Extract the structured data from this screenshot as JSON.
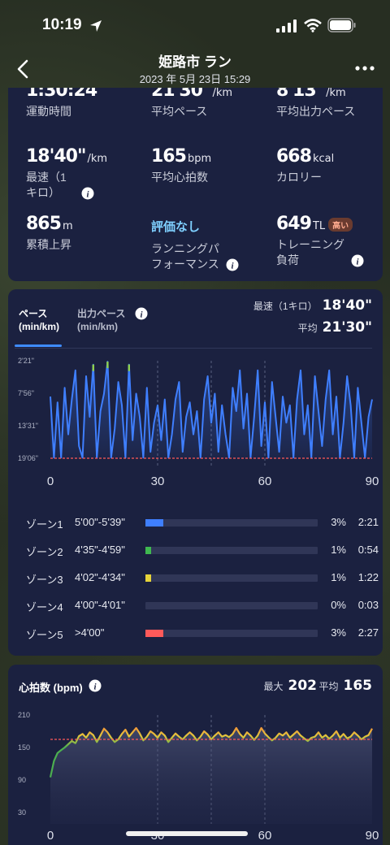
{
  "status_bar": {
    "time": "10:19"
  },
  "header": {
    "title": "姫路市 ラン",
    "subtitle": "2023 年 5月 23日 15:29"
  },
  "stats": {
    "row0": [
      {
        "value": "1:30:24",
        "unit": "",
        "label": "運動時間"
      },
      {
        "value": "21'30\"",
        "unit": "/km",
        "label": "平均ペース"
      },
      {
        "value": "8'13\"",
        "unit": "/km",
        "label": "平均出力ペース"
      }
    ],
    "row1": [
      {
        "value": "18'40\"",
        "unit": "/km",
        "label_line1": "最速（1",
        "label_line2": "キロ）"
      },
      {
        "value": "165",
        "unit": "bpm",
        "label": "平均心拍数"
      },
      {
        "value": "668",
        "unit": "kcal",
        "label": "カロリー"
      }
    ],
    "row2": [
      {
        "value": "865",
        "unit": "m",
        "label": "累積上昇"
      },
      {
        "value": "評価なし",
        "label_line1": "ランニングパ",
        "label_line2": "フォーマンス"
      },
      {
        "value": "649",
        "unit": "TL",
        "badge": "高い",
        "label_line1": "トレーニング",
        "label_line2": "負荷"
      }
    ]
  },
  "pace": {
    "tabs": [
      {
        "line1": "ペース",
        "line2": "(min/km)"
      },
      {
        "line1": "出力ペース",
        "line2": "(min/km)"
      }
    ],
    "fastest_label": "最速（1キロ）",
    "fastest_value": "18'40\"",
    "avg_label": "平均",
    "avg_value": "21'30\"",
    "zones": [
      {
        "name": "ゾーン1",
        "range": "5'00\"-5'39\"",
        "pct": "3%",
        "time": "2:21",
        "fraction": 0.03,
        "color": "#3f7fff"
      },
      {
        "name": "ゾーン2",
        "range": "4'35\"-4'59\"",
        "pct": "1%",
        "time": "0:54",
        "fraction": 0.01,
        "color": "#3fb950"
      },
      {
        "name": "ゾーン3",
        "range": "4'02\"-4'34\"",
        "pct": "1%",
        "time": "1:22",
        "fraction": 0.01,
        "color": "#e6d33a"
      },
      {
        "name": "ゾーン4",
        "range": "4'00\"-4'01\"",
        "pct": "0%",
        "time": "0:03",
        "fraction": 0.0,
        "color": "#f08a3a"
      },
      {
        "name": "ゾーン5",
        "range": ">4'00\"",
        "pct": "3%",
        "time": "2:27",
        "fraction": 0.03,
        "color": "#ff5a5a"
      }
    ]
  },
  "heart_rate": {
    "title": "心拍数 (bpm)",
    "max_label": "最大",
    "max_value": "202",
    "avg_label": "平均",
    "avg_value": "165"
  },
  "chart_data": [
    {
      "type": "line",
      "series": [
        {
          "values": [
            8.5,
            19.0,
            9.5,
            19.0,
            7.0,
            15.0,
            9.0,
            4.0,
            17.0,
            19.0,
            5.0,
            12.0,
            3.0,
            19.0,
            11.0,
            8.0,
            2.5,
            19.0,
            14.0,
            6.0,
            10.0,
            19.0,
            3.0,
            16.0,
            8.0,
            12.0,
            19.0,
            7.0,
            18.0,
            13.0,
            10.0,
            16.0,
            9.0,
            19.0,
            15.0,
            9.0,
            6.0,
            18.0,
            12.0,
            9.5,
            15.0,
            11.0,
            19.0,
            9.0,
            5.0,
            13.0,
            8.0,
            18.0,
            10.0,
            15.0,
            19.0,
            7.0,
            11.0,
            4.0,
            14.0,
            8.0,
            19.0,
            12.0,
            4.0,
            17.0,
            9.5,
            19.0,
            6.0,
            12.0,
            18.0,
            8.5,
            13.0,
            10.0,
            19.0,
            9.0,
            4.0,
            15.0,
            10.0,
            19.0,
            5.0,
            11.0,
            17.0,
            9.0,
            4.0,
            15.0,
            8.5,
            19.0,
            13.0,
            5.0,
            10.0,
            19.0,
            7.0,
            13.0,
            19.0,
            12.0,
            9.0
          ]
        }
      ],
      "x": [
        0,
        1,
        2,
        3,
        4,
        5,
        6,
        7,
        8,
        9,
        10,
        11,
        12,
        13,
        14,
        15,
        16,
        17,
        18,
        19,
        20,
        21,
        22,
        23,
        24,
        25,
        26,
        27,
        28,
        29,
        30,
        31,
        32,
        33,
        34,
        35,
        36,
        37,
        38,
        39,
        40,
        41,
        42,
        43,
        44,
        45,
        46,
        47,
        48,
        49,
        50,
        51,
        52,
        53,
        54,
        55,
        56,
        57,
        58,
        59,
        60,
        61,
        62,
        63,
        64,
        65,
        66,
        67,
        68,
        69,
        70,
        71,
        72,
        73,
        74,
        75,
        76,
        77,
        78,
        79,
        80,
        81,
        82,
        83,
        84,
        85,
        86,
        87,
        88,
        89,
        90
      ],
      "xticks": [
        "0",
        "30",
        "60",
        "90"
      ],
      "yticks": [
        "2'21\"",
        "7'56\"",
        "13'31\"",
        "19'06\""
      ],
      "ylim": [
        2.35,
        19.1
      ],
      "y_inverted": true,
      "reference_line": 19.1,
      "colors": {
        "line": "#3f7fff",
        "fast_tip": "#8fd14f",
        "reference": "#ff5a5a"
      }
    },
    {
      "type": "area",
      "series": [
        {
          "values": [
            95,
            125,
            140,
            145,
            150,
            156,
            162,
            158,
            171,
            175,
            168,
            178,
            173,
            160,
            172,
            185,
            178,
            168,
            160,
            165,
            175,
            183,
            170,
            178,
            186,
            176,
            163,
            170,
            180,
            175,
            168,
            178,
            172,
            160,
            168,
            176,
            170,
            165,
            172,
            178,
            172,
            163,
            170,
            180,
            174,
            165,
            172,
            178,
            170,
            173,
            169,
            175,
            186,
            175,
            168,
            178,
            172,
            164,
            172,
            186,
            176,
            169,
            163,
            168,
            176,
            172,
            178,
            168,
            174,
            180,
            172,
            167,
            162,
            168,
            170,
            178,
            168,
            173,
            166,
            172,
            180,
            168,
            175,
            167,
            170,
            178,
            172,
            165,
            170,
            173,
            185
          ]
        }
      ],
      "x": [
        0,
        1,
        2,
        3,
        4,
        5,
        6,
        7,
        8,
        9,
        10,
        11,
        12,
        13,
        14,
        15,
        16,
        17,
        18,
        19,
        20,
        21,
        22,
        23,
        24,
        25,
        26,
        27,
        28,
        29,
        30,
        31,
        32,
        33,
        34,
        35,
        36,
        37,
        38,
        39,
        40,
        41,
        42,
        43,
        44,
        45,
        46,
        47,
        48,
        49,
        50,
        51,
        52,
        53,
        54,
        55,
        56,
        57,
        58,
        59,
        60,
        61,
        62,
        63,
        64,
        65,
        66,
        67,
        68,
        69,
        70,
        71,
        72,
        73,
        74,
        75,
        76,
        77,
        78,
        79,
        80,
        81,
        82,
        83,
        84,
        85,
        86,
        87,
        88,
        89,
        90
      ],
      "xticks": [
        "0",
        "30",
        "60",
        "90"
      ],
      "yticks": [
        "210",
        "150",
        "90",
        "30"
      ],
      "ylim": [
        30,
        210
      ],
      "reference_line": 165,
      "colors": {
        "green": "#4caf50",
        "yellow": "#e6c53a",
        "orange": "#f08a3a",
        "reference": "#ff5a5a"
      }
    }
  ]
}
